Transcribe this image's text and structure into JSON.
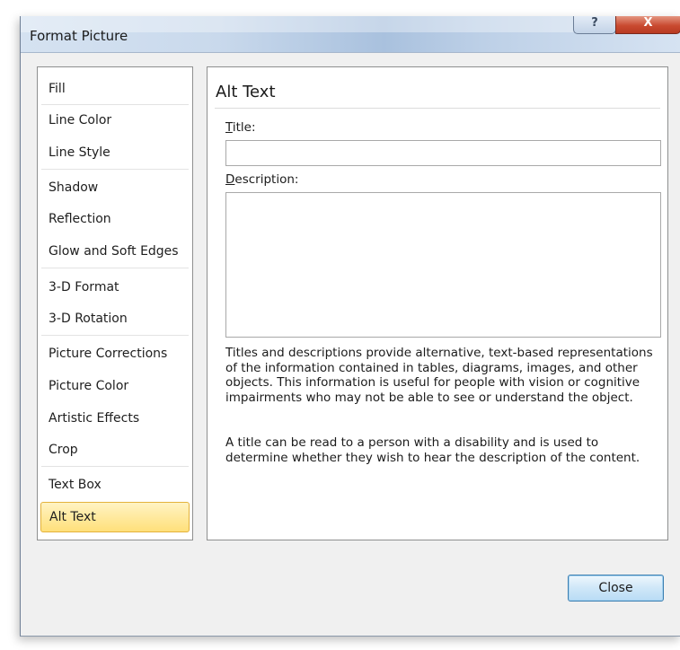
{
  "window": {
    "title": "Format Picture",
    "help_label": "?",
    "close_label": "X"
  },
  "nav": {
    "items": [
      {
        "label": "Fill",
        "selected": false
      },
      {
        "label": "Line Color",
        "selected": false
      },
      {
        "label": "Line Style",
        "selected": false
      },
      {
        "label": "Shadow",
        "selected": false
      },
      {
        "label": "Reflection",
        "selected": false
      },
      {
        "label": "Glow and Soft Edges",
        "selected": false
      },
      {
        "label": "3-D Format",
        "selected": false
      },
      {
        "label": "3-D Rotation",
        "selected": false
      },
      {
        "label": "Picture Corrections",
        "selected": false
      },
      {
        "label": "Picture Color",
        "selected": false
      },
      {
        "label": "Artistic Effects",
        "selected": false
      },
      {
        "label": "Crop",
        "selected": false
      },
      {
        "label": "Text Box",
        "selected": false
      },
      {
        "label": "Alt Text",
        "selected": true
      }
    ],
    "selected_color": "#ffe07a"
  },
  "panel": {
    "heading": "Alt Text",
    "title_label_accel": "T",
    "title_label_rest": "itle:",
    "title_value": "",
    "description_label_accel": "D",
    "description_label_rest": "escription:",
    "description_value": "",
    "paragraph_1": "Titles and descriptions provide alternative, text-based representations of the information contained in tables, diagrams, images, and other objects. This information is useful for people with vision or cognitive impairments who may not be able to see or understand the object.",
    "paragraph_2": "A title can be read to a person with a disability and is used to determine whether they wish to hear the description of the content."
  },
  "footer": {
    "close_button": "Close"
  }
}
